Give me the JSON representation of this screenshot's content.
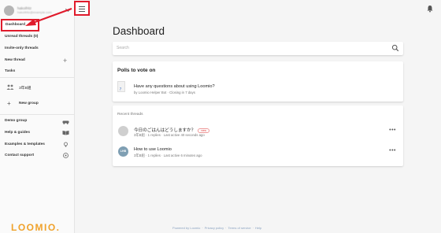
{
  "sidebar": {
    "user_name": "hakoifritz",
    "user_email": "hakoifritz@example.com",
    "active_item": "Dashboard",
    "items": {
      "unread": "Unread threads (0)",
      "invite_only": "Invite-only threads",
      "new_thread": "New thread",
      "tasks": "Tasks"
    },
    "group": "3年B組",
    "new_group": "New group",
    "links": {
      "demo_group": "Demo group",
      "help": "Help & guides",
      "examples": "Examples & templates",
      "contact": "Contact support"
    },
    "logo": "LOOMIO."
  },
  "main": {
    "title": "Dashboard",
    "search_placeholder": "Search",
    "polls": {
      "title": "Polls to vote on",
      "question": "Have any questions about using Loomio?",
      "meta": "by Loomio Helper Bot · Closing in 7 days"
    },
    "threads": {
      "heading": "Recent threads",
      "items": [
        {
          "title": "今日のごはんはどうしますか？",
          "badge": "new",
          "meta": "3年B組 · 1 replies · Last active 40 seconds ago",
          "avatar_color": "#cfcfcf",
          "avatar_text": ""
        },
        {
          "title": "How to use Loomio",
          "badge": "",
          "meta": "3年B組 · 1 replies · Last active 6 minutes ago",
          "avatar_color": "#7f9fb3",
          "avatar_text": "LHB"
        }
      ]
    }
  },
  "footer": {
    "powered": "Powered by Loomio",
    "privacy": "Privacy policy",
    "terms": "Terms of service",
    "help": "Help"
  },
  "colors": {
    "highlight_red": "#e01b2c",
    "brand_orange": "#f0a22b"
  }
}
